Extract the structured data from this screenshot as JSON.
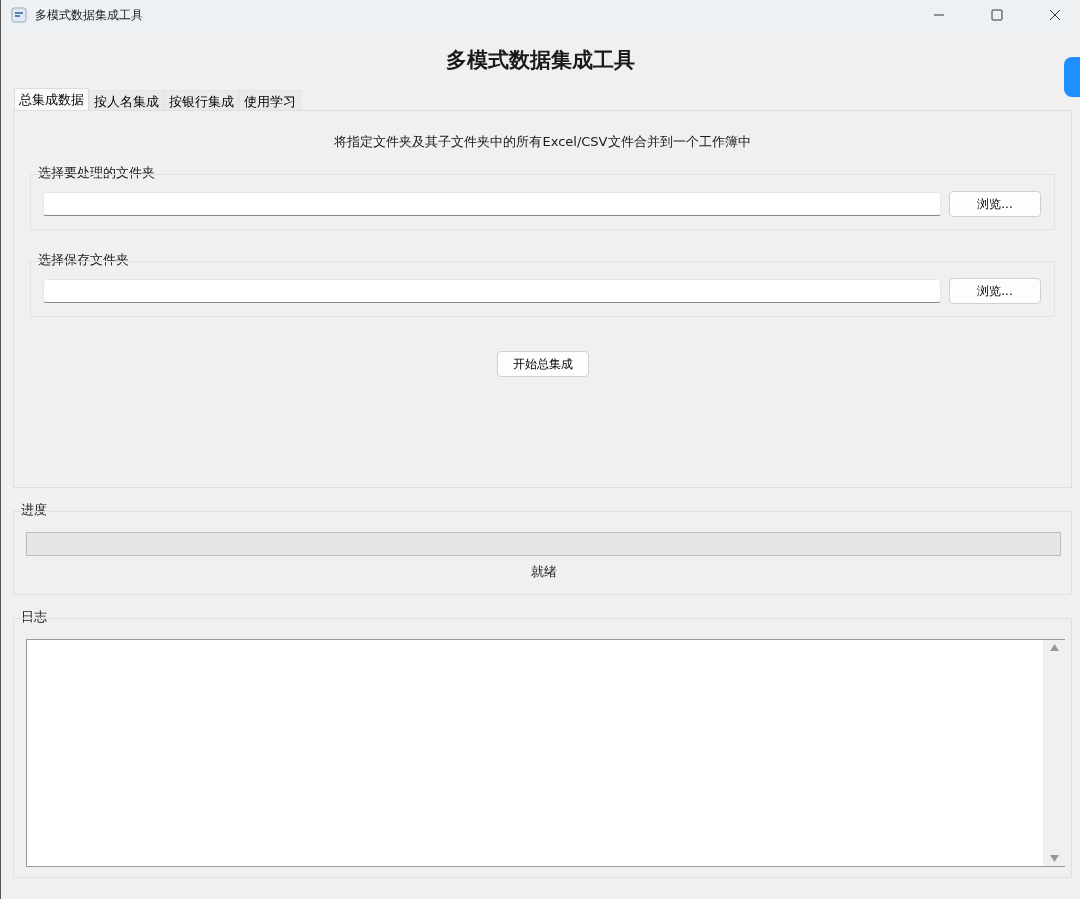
{
  "window": {
    "title": "多模式数据集成工具"
  },
  "heading": "多模式数据集成工具",
  "tabs": [
    {
      "label": "总集成数据",
      "selected": true
    },
    {
      "label": "按人名集成",
      "selected": false
    },
    {
      "label": "按银行集成",
      "selected": false
    },
    {
      "label": "使用学习",
      "selected": false
    }
  ],
  "panel": {
    "description": "将指定文件夹及其子文件夹中的所有Excel/CSV文件合并到一个工作簿中",
    "groups": [
      {
        "title": "选择要处理的文件夹",
        "button": "浏览..."
      },
      {
        "title": "选择保存文件夹",
        "button": "浏览..."
      }
    ],
    "start_button": "开始总集成"
  },
  "progress": {
    "title": "进度",
    "level": 0,
    "status": "就绪"
  },
  "log": {
    "title": "日志"
  }
}
